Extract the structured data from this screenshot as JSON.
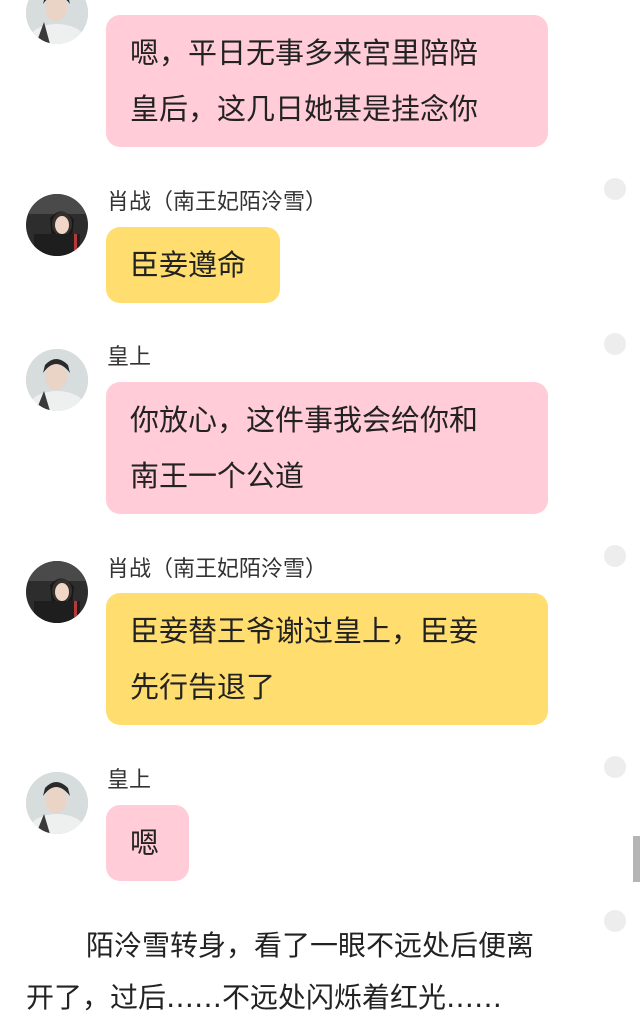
{
  "chat": {
    "messages": [
      {
        "sender": "",
        "lines": [
          "嗯，平日无事多来宫里陪陪",
          "皇后，这几日她甚是挂念你"
        ],
        "bubble_color": "#ffccd8",
        "avatar": "emperor-avatar"
      },
      {
        "sender": "肖战（南王妃陌泠雪）",
        "lines": [
          "臣妾遵命"
        ],
        "bubble_color": "#ffdd6e",
        "avatar": "consort-avatar"
      },
      {
        "sender": "皇上",
        "lines": [
          "你放心，这件事我会给你和",
          "南王一个公道"
        ],
        "bubble_color": "#ffccd8",
        "avatar": "emperor-avatar"
      },
      {
        "sender": "肖战（南王妃陌泠雪）",
        "lines": [
          "臣妾替王爷谢过皇上，臣妾",
          "先行告退了"
        ],
        "bubble_color": "#ffdd6e",
        "avatar": "consort-avatar"
      },
      {
        "sender": "皇上",
        "lines": [
          "嗯"
        ],
        "bubble_color": "#ffccd8",
        "avatar": "emperor-avatar"
      }
    ]
  },
  "narration": {
    "lines": [
      "陌泠雪转身，看了一眼不远处后便离",
      "开了，过后……不远处闪烁着红光……"
    ]
  },
  "colors": {
    "pink_bubble": "#ffccd8",
    "yellow_bubble": "#ffdd6e",
    "background": "#ffffff"
  }
}
